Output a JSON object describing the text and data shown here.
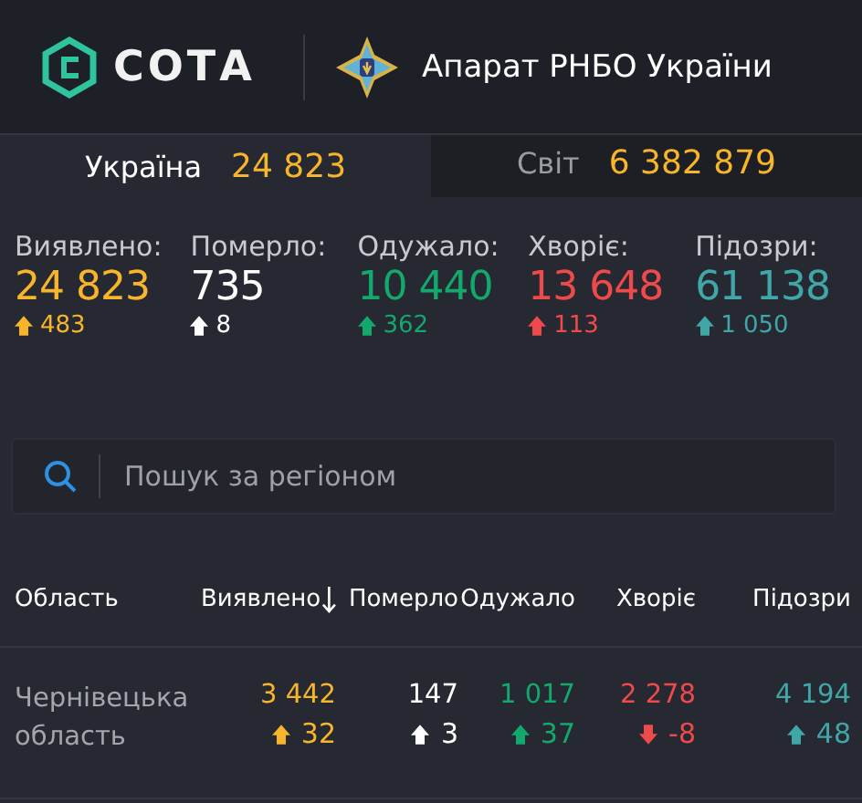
{
  "header": {
    "logo": "СОТА",
    "agency": "Апарат РНБО України"
  },
  "tabs": [
    {
      "label": "Україна",
      "count": "24 823",
      "selected": true
    },
    {
      "label": "Світ",
      "count": "6 382 879",
      "selected": false
    }
  ],
  "stats": [
    {
      "label": "Виявлено:",
      "value": "24 823",
      "delta": "483",
      "kind": "up",
      "color": "#f7b52c"
    },
    {
      "label": "Померло:",
      "value": "735",
      "delta": "8",
      "kind": "up",
      "color": "#ffffff"
    },
    {
      "label": "Одужало:",
      "value": "10 440",
      "delta": "362",
      "kind": "up",
      "color": "#13a86c"
    },
    {
      "label": "Хворіє:",
      "value": "13 648",
      "delta": "113",
      "kind": "up",
      "color": "#ef4a4b"
    },
    {
      "label": "Підозри:",
      "value": "61 138",
      "delta": "1 050",
      "kind": "up",
      "color": "#40a6a8"
    }
  ],
  "search": {
    "placeholder": "Пошук за регіоном"
  },
  "table": {
    "columns": [
      {
        "label": "Область",
        "sorted": false
      },
      {
        "label": "Виявлено",
        "sorted": true,
        "color": "#f7b52c"
      },
      {
        "label": "Померло",
        "sorted": false,
        "color": "#ffffff"
      },
      {
        "label": "Одужало",
        "sorted": false,
        "color": "#13a86c"
      },
      {
        "label": "Хворіє",
        "sorted": false,
        "color": "#ef4a4b"
      },
      {
        "label": "Підозри",
        "sorted": false,
        "color": "#40a6a8"
      }
    ],
    "rows": [
      {
        "cells": [
          {
            "value": "Чернівецька область"
          },
          {
            "value": "3 442",
            "delta": "32",
            "kind": "up"
          },
          {
            "value": "147",
            "delta": "3",
            "kind": "up"
          },
          {
            "value": "1 017",
            "delta": "37",
            "kind": "up"
          },
          {
            "value": "2 278",
            "delta": "-8",
            "kind": "down"
          },
          {
            "value": "4 194",
            "delta": "48",
            "kind": "up"
          }
        ]
      }
    ]
  }
}
